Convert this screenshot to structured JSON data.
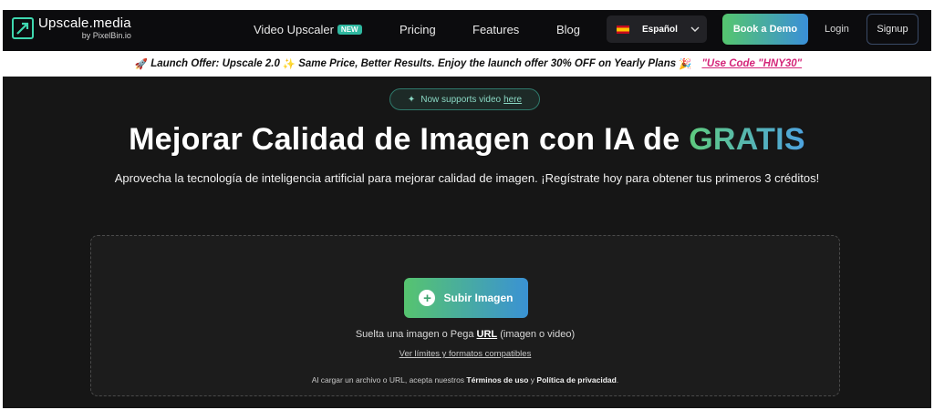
{
  "brand": {
    "title": "Upscale.media",
    "subtitle": "by PixelBin.io"
  },
  "nav": {
    "video_upscaler": "Video Upscaler",
    "new_badge": "NEW",
    "pricing": "Pricing",
    "features": "Features",
    "blog": "Blog",
    "language": "Español",
    "book_demo": "Book a Demo",
    "login": "Login",
    "signup": "Signup"
  },
  "promo": {
    "text_part1": "Launch Offer: Upscale 2.0",
    "text_part2": "Same Price, Better Results. Enjoy the launch offer 30% OFF on Yearly Plans",
    "code": "\"Use Code \"HNY30\""
  },
  "hero": {
    "pill_text": "Now supports video",
    "pill_link": "here",
    "title_main": "Mejorar Calidad de Imagen con IA de ",
    "title_highlight": "GRATIS",
    "subtitle": "Aprovecha la tecnología de inteligencia artificial para mejorar calidad de imagen. ¡Regístrate hoy para obtener tus primeros 3 créditos!"
  },
  "upload": {
    "button": "Subir Imagen",
    "drop_prefix": "Suelta una imagen o Pega ",
    "drop_url": "URL",
    "drop_suffix": " (imagen o video)",
    "limits_link": "Ver límites y formatos compatibles",
    "terms_prefix": "Al cargar un archivo o URL, acepta nuestros ",
    "terms_link": "Términos de uso",
    "terms_and": " y ",
    "privacy_link": "Política de privacidad",
    "terms_end": "."
  },
  "colors": {
    "accent_green": "#56c46f",
    "accent_blue": "#3a92d4",
    "promo_code": "#d4267a"
  },
  "icons": [
    "upscale-logo-icon",
    "spain-flag-icon",
    "chevron-down-icon",
    "rocket-icon",
    "sparkle-icon",
    "party-icon",
    "plus-icon"
  ]
}
